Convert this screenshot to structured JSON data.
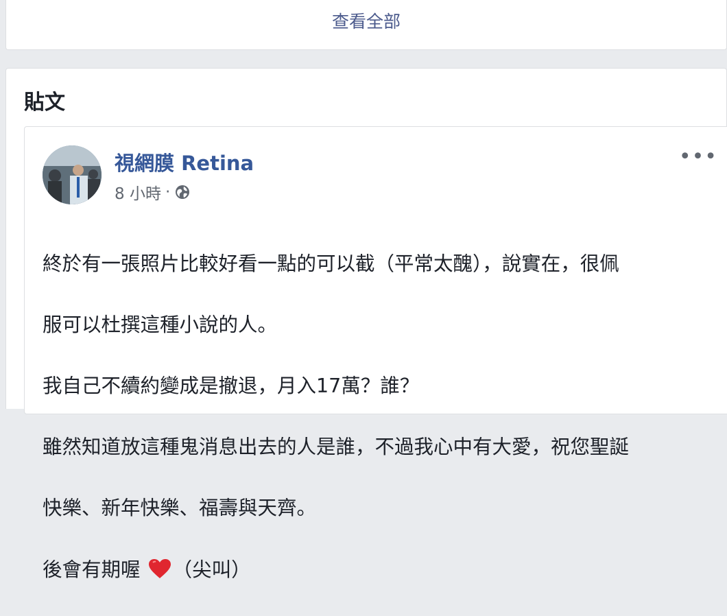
{
  "top": {
    "see_all": "查看全部"
  },
  "section": {
    "title": "貼文"
  },
  "post": {
    "author": "視網膜 Retina",
    "time": "8 小時",
    "separator": "·",
    "more_label": "•••",
    "lines": [
      "終於有一張照片比較好看一點的可以截（平常太醜），說實在，很佩",
      "服可以杜撰這種小說的人。",
      "我自己不續約變成是撤退，月入17萬？誰？",
      "雖然知道放這種鬼消息出去的人是誰，不過我心中有大愛，祝您聖誕",
      "快樂、新年快樂、福壽與天齊。"
    ],
    "last_line_before": "後會有期喔 ",
    "last_line_after": "（尖叫）",
    "heart_icon": "red-heart-emoji",
    "globe_icon": "globe-icon"
  }
}
